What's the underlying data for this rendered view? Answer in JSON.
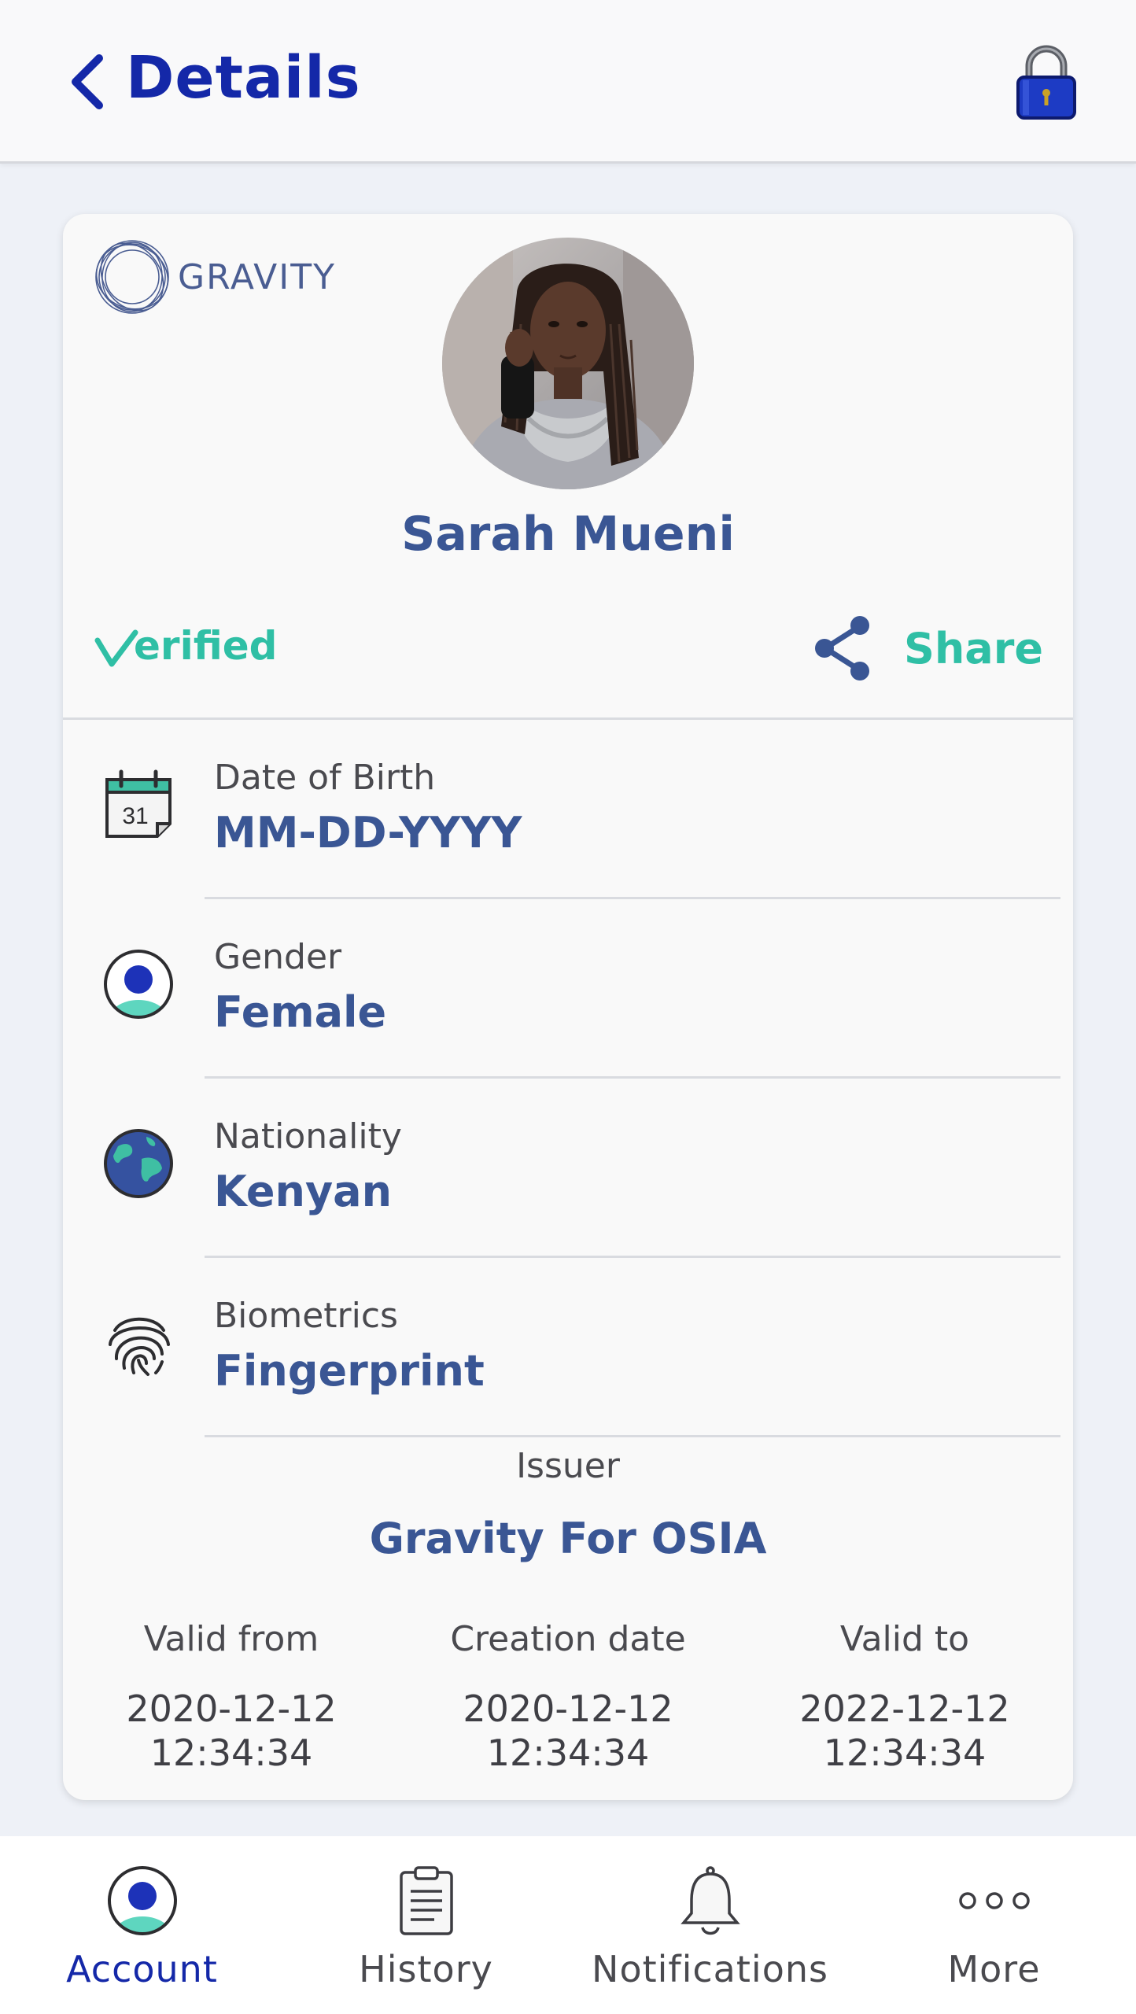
{
  "header": {
    "title": "Details"
  },
  "card": {
    "brand_name": "GRAVITY",
    "person_name": "Sarah Mueni",
    "verified_label": "erified",
    "share_label": "Share",
    "fields": [
      {
        "label": "Date of Birth",
        "value": "MM-DD-YYYY",
        "icon": "calendar-icon",
        "calendar_day": "31"
      },
      {
        "label": "Gender",
        "value": "Female",
        "icon": "user-icon"
      },
      {
        "label": "Nationality",
        "value": "Kenyan",
        "icon": "globe-icon"
      },
      {
        "label": "Biometrics",
        "value": "Fingerprint",
        "icon": "fingerprint-icon"
      }
    ],
    "issuer_label": "Issuer",
    "issuer_value": "Gravity For OSIA",
    "dates": [
      {
        "title": "Valid from",
        "date": "2020-12-12",
        "time": "12:34:34"
      },
      {
        "title": "Creation date",
        "date": "2020-12-12",
        "time": "12:34:34"
      },
      {
        "title": "Valid to",
        "date": "2022-12-12",
        "time": "12:34:34"
      }
    ]
  },
  "nav": {
    "items": [
      {
        "label": "Account",
        "icon": "account-icon",
        "active": true
      },
      {
        "label": "History",
        "icon": "clipboard-icon",
        "active": false
      },
      {
        "label": "Notifications",
        "icon": "bell-icon",
        "active": false
      },
      {
        "label": "More",
        "icon": "more-icon",
        "active": false
      }
    ]
  },
  "colors": {
    "primary": "#1428a8",
    "accent_teal": "#2fbfa5",
    "value_blue": "#3a5694"
  }
}
